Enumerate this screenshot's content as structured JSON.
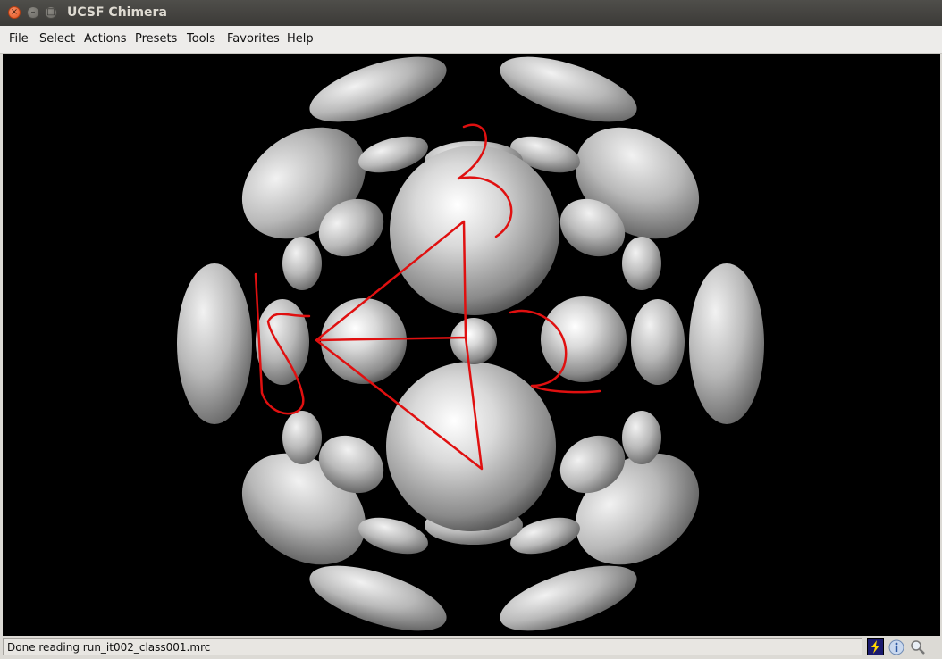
{
  "window": {
    "title": "UCSF Chimera",
    "close_glyph": "×",
    "min_glyph": "–",
    "max_glyph": "□"
  },
  "menu": {
    "items": [
      {
        "label": "File"
      },
      {
        "label": "Select"
      },
      {
        "label": "Actions"
      },
      {
        "label": "Presets"
      },
      {
        "label": "Tools"
      },
      {
        "label": "Favorites"
      },
      {
        "label": "Help"
      }
    ]
  },
  "viewport": {
    "background": "#000000",
    "annotation_color": "#e01010",
    "surface_color": "#bdbdbd"
  },
  "status": {
    "message": "Done reading run_it002_class001.mrc",
    "icons": [
      "bolt-icon",
      "info-icon",
      "magnifier-icon"
    ]
  }
}
